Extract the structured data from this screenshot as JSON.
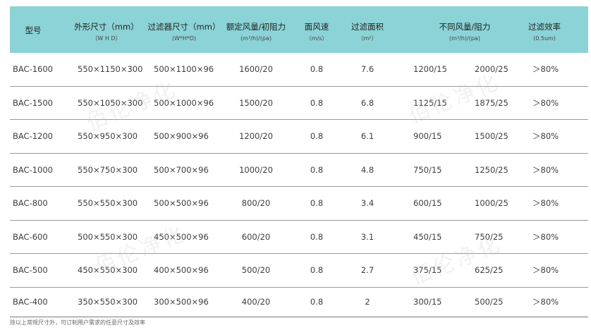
{
  "headers": [
    {
      "main": "型号",
      "sub": ""
    },
    {
      "main": "外形尺寸（mm）",
      "sub": "（W H D）"
    },
    {
      "main": "过滤器尺寸（mm）",
      "sub": "(W*H*D)"
    },
    {
      "main": "额定风量/初阻力",
      "sub": "(m³/h)/(pa)"
    },
    {
      "main": "面风速",
      "sub": "（m/s）"
    },
    {
      "main": "过滤面积",
      "sub": "（m²）"
    },
    {
      "main": "不同风量/阻力",
      "sub": "(m³/h)/(pa)"
    },
    {
      "main": "过滤效率",
      "sub": "(0.5um)"
    }
  ],
  "rows": [
    {
      "model": "BAC-1600",
      "outer": "550×1150×300",
      "filter": "500×1100×96",
      "rated": "1600/20",
      "speed": "0.8",
      "area": "7.6",
      "v1": "1200/15",
      "v2": "2000/25",
      "eff": "＞80%"
    },
    {
      "model": "BAC-1500",
      "outer": "550×1050×300",
      "filter": "500×1000×96",
      "rated": "1500/20",
      "speed": "0.8",
      "area": "6.8",
      "v1": "1125/15",
      "v2": "1875/25",
      "eff": "＞80%"
    },
    {
      "model": "BAC-1200",
      "outer": "550×950×300",
      "filter": "500×900×96",
      "rated": "1200/20",
      "speed": "0.8",
      "area": "6.1",
      "v1": "900/15",
      "v2": "1500/25",
      "eff": "＞80%"
    },
    {
      "model": "BAC-1000",
      "outer": "550×750×300",
      "filter": "500×700×96",
      "rated": "1000/20",
      "speed": "0.8",
      "area": "4.8",
      "v1": "750/15",
      "v2": "1250/25",
      "eff": "＞80%"
    },
    {
      "model": "BAC-800",
      "outer": "550×550×300",
      "filter": "500×500×96",
      "rated": "800/20",
      "speed": "0.8",
      "area": "3.4",
      "v1": "600/15",
      "v2": "1000/25",
      "eff": "＞80%"
    },
    {
      "model": "BAC-600",
      "outer": "500×550×300",
      "filter": "450×500×96",
      "rated": "600/20",
      "speed": "0.8",
      "area": "3.1",
      "v1": "450/15",
      "v2": "750/25",
      "eff": "＞80%"
    },
    {
      "model": "BAC-500",
      "outer": "450×550×300",
      "filter": "400×500×96",
      "rated": "500/20",
      "speed": "0.8",
      "area": "2.7",
      "v1": "375/15",
      "v2": "625/25",
      "eff": "＞80%"
    },
    {
      "model": "BAC-400",
      "outer": "350×550×300",
      "filter": "300×500×96",
      "rated": "400/20",
      "speed": "0.8",
      "area": "2",
      "v1": "300/15",
      "v2": "500/25",
      "eff": "＞80%"
    }
  ],
  "footnote": "除以上常规尺寸外，可订制用户需求的任意尺寸及效率",
  "watermark_text": "佰伦净化",
  "colors": {
    "header_bg": "#8bd3d6",
    "rule": "#9a9a9a"
  }
}
